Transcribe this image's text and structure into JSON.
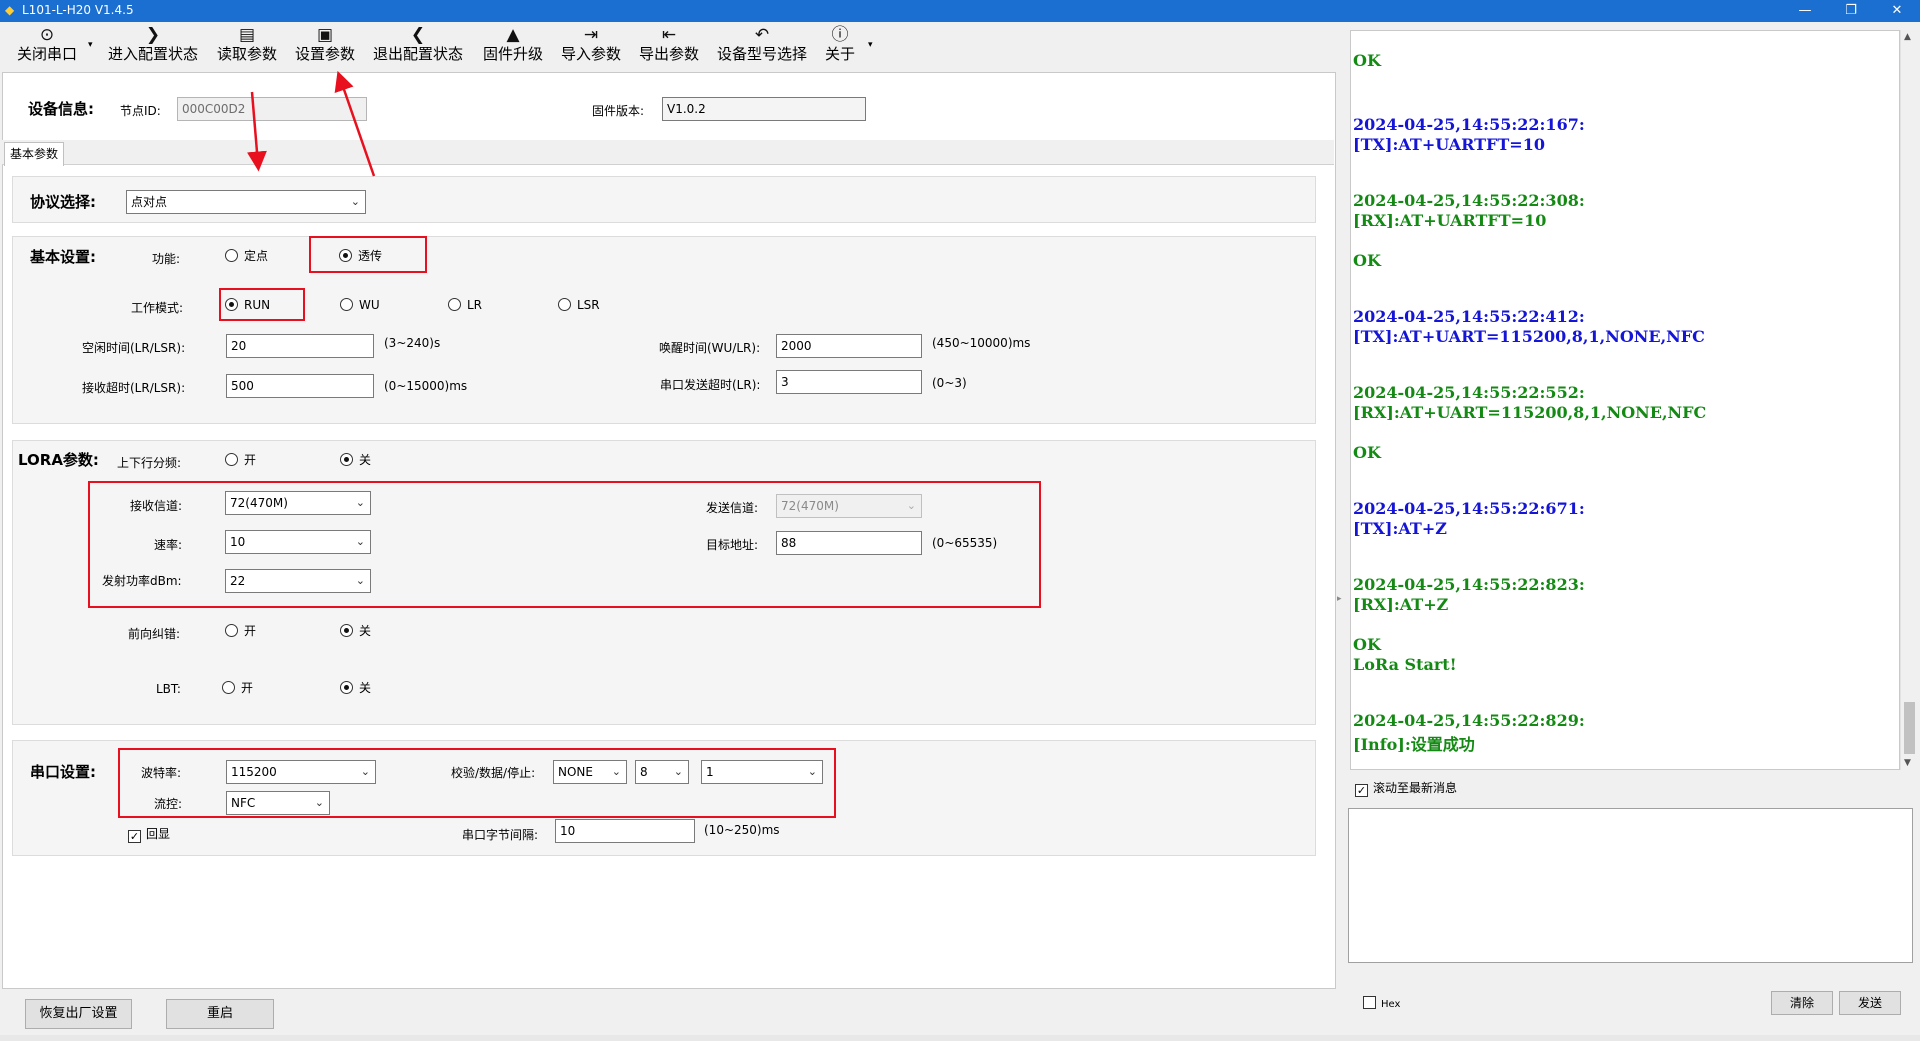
{
  "window": {
    "title": "L101-L-H20 V1.4.5",
    "min": "—",
    "max": "❐",
    "close": "✕"
  },
  "toolbar": {
    "close_port": "关闭串口",
    "enter_config": "进入配置状态",
    "read_params": "读取参数",
    "set_params": "设置参数",
    "exit_config": "退出配置状态",
    "firmware_upgrade": "固件升级",
    "import_params": "导入参数",
    "export_params": "导出参数",
    "model_select": "设备型号选择",
    "about": "关于"
  },
  "device_info": {
    "title": "设备信息:",
    "node_id_label": "节点ID:",
    "node_id": "000C00D2",
    "fw_label": "固件版本:",
    "fw_version": "V1.0.2"
  },
  "tabs": {
    "basic": "基本参数"
  },
  "protocol": {
    "label": "协议选择:",
    "value": "点对点"
  },
  "basic": {
    "title": "基本设置:",
    "function_label": "功能:",
    "fixed": "定点",
    "transparent": "透传",
    "mode_label": "工作模式:",
    "run": "RUN",
    "wu": "WU",
    "lr": "LR",
    "lsr": "LSR",
    "idle_label": "空闲时间(LR/LSR):",
    "idle_value": "20",
    "idle_range": "(3~240)s",
    "wake_label": "唤醒时间(WU/LR):",
    "wake_value": "2000",
    "wake_range": "(450~10000)ms",
    "recv_timeout_label": "接收超时(LR/LSR):",
    "recv_timeout_value": "500",
    "recv_timeout_range": "(0~15000)ms",
    "uart_timeout_label": "串口发送超时(LR):",
    "uart_timeout_value": "3",
    "uart_timeout_range": "(0~3)"
  },
  "lora": {
    "title": "LORA参数:",
    "split_label": "上下行分频:",
    "on": "开",
    "off": "关",
    "rx_channel_label": "接收信道:",
    "rx_channel": "72(470M)",
    "tx_channel_label": "发送信道:",
    "tx_channel": "72(470M)",
    "rate_label": "速率:",
    "rate": "10",
    "target_label": "目标地址:",
    "target": "88",
    "target_range": "(0~65535)",
    "power_label": "发射功率dBm:",
    "power": "22",
    "fec_label": "前向纠错:",
    "lbt_label": "LBT:"
  },
  "serial": {
    "title": "串口设置:",
    "baud_label": "波特率:",
    "baud": "115200",
    "parity_label": "校验/数据/停止:",
    "parity": "NONE",
    "data_bits": "8",
    "stop_bits": "1",
    "flow_label": "流控:",
    "flow": "NFC",
    "echo_label": "回显",
    "interval_label": "串口字节间隔:",
    "interval": "10",
    "interval_range": "(10~250)ms"
  },
  "bottom": {
    "factory_reset": "恢复出厂设置",
    "restart": "重启"
  },
  "log": {
    "lines": [
      {
        "text": "OK",
        "cls": "okc"
      },
      {
        "text": "2024-04-25,14:55:22:167:",
        "cls": "tx"
      },
      {
        "text": "[TX]:AT+UARTFT=10",
        "cls": "tx"
      },
      {
        "text": "2024-04-25,14:55:22:308:",
        "cls": "rx"
      },
      {
        "text": "[RX]:AT+UARTFT=10",
        "cls": "rx"
      },
      {
        "text": "OK",
        "cls": "okc"
      },
      {
        "text": "2024-04-25,14:55:22:412:",
        "cls": "tx"
      },
      {
        "text": "[TX]:AT+UART=115200,8,1,NONE,NFC",
        "cls": "tx"
      },
      {
        "text": "2024-04-25,14:55:22:552:",
        "cls": "rx"
      },
      {
        "text": "[RX]:AT+UART=115200,8,1,NONE,NFC",
        "cls": "rx"
      },
      {
        "text": "OK",
        "cls": "okc"
      },
      {
        "text": "2024-04-25,14:55:22:671:",
        "cls": "tx"
      },
      {
        "text": "[TX]:AT+Z",
        "cls": "tx"
      },
      {
        "text": "2024-04-25,14:55:22:823:",
        "cls": "rx"
      },
      {
        "text": "[RX]:AT+Z",
        "cls": "rx"
      },
      {
        "text": "OK",
        "cls": "okc"
      },
      {
        "text": "LoRa Start!",
        "cls": "okc"
      },
      {
        "text": "2024-04-25,14:55:22:829:",
        "cls": "rx"
      },
      {
        "text": "[Info]:设置成功",
        "cls": "rx"
      }
    ],
    "autoscroll_label": "滚动至最新消息",
    "hex_label": "Hex",
    "clear": "清除",
    "send": "发送"
  }
}
